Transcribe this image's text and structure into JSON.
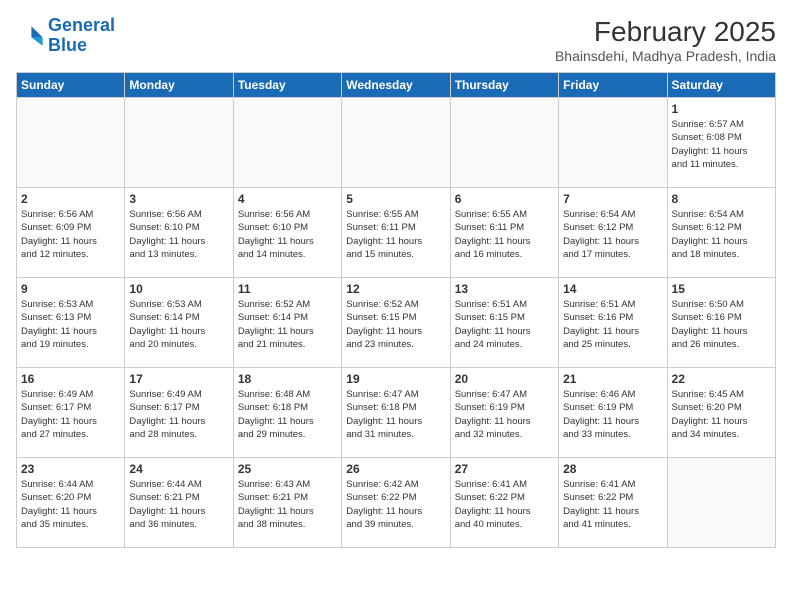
{
  "logo": {
    "line1": "General",
    "line2": "Blue"
  },
  "title": "February 2025",
  "location": "Bhainsdehi, Madhya Pradesh, India",
  "weekdays": [
    "Sunday",
    "Monday",
    "Tuesday",
    "Wednesday",
    "Thursday",
    "Friday",
    "Saturday"
  ],
  "weeks": [
    [
      {
        "day": "",
        "info": ""
      },
      {
        "day": "",
        "info": ""
      },
      {
        "day": "",
        "info": ""
      },
      {
        "day": "",
        "info": ""
      },
      {
        "day": "",
        "info": ""
      },
      {
        "day": "",
        "info": ""
      },
      {
        "day": "1",
        "info": "Sunrise: 6:57 AM\nSunset: 6:08 PM\nDaylight: 11 hours\nand 11 minutes."
      }
    ],
    [
      {
        "day": "2",
        "info": "Sunrise: 6:56 AM\nSunset: 6:09 PM\nDaylight: 11 hours\nand 12 minutes."
      },
      {
        "day": "3",
        "info": "Sunrise: 6:56 AM\nSunset: 6:10 PM\nDaylight: 11 hours\nand 13 minutes."
      },
      {
        "day": "4",
        "info": "Sunrise: 6:56 AM\nSunset: 6:10 PM\nDaylight: 11 hours\nand 14 minutes."
      },
      {
        "day": "5",
        "info": "Sunrise: 6:55 AM\nSunset: 6:11 PM\nDaylight: 11 hours\nand 15 minutes."
      },
      {
        "day": "6",
        "info": "Sunrise: 6:55 AM\nSunset: 6:11 PM\nDaylight: 11 hours\nand 16 minutes."
      },
      {
        "day": "7",
        "info": "Sunrise: 6:54 AM\nSunset: 6:12 PM\nDaylight: 11 hours\nand 17 minutes."
      },
      {
        "day": "8",
        "info": "Sunrise: 6:54 AM\nSunset: 6:12 PM\nDaylight: 11 hours\nand 18 minutes."
      }
    ],
    [
      {
        "day": "9",
        "info": "Sunrise: 6:53 AM\nSunset: 6:13 PM\nDaylight: 11 hours\nand 19 minutes."
      },
      {
        "day": "10",
        "info": "Sunrise: 6:53 AM\nSunset: 6:14 PM\nDaylight: 11 hours\nand 20 minutes."
      },
      {
        "day": "11",
        "info": "Sunrise: 6:52 AM\nSunset: 6:14 PM\nDaylight: 11 hours\nand 21 minutes."
      },
      {
        "day": "12",
        "info": "Sunrise: 6:52 AM\nSunset: 6:15 PM\nDaylight: 11 hours\nand 23 minutes."
      },
      {
        "day": "13",
        "info": "Sunrise: 6:51 AM\nSunset: 6:15 PM\nDaylight: 11 hours\nand 24 minutes."
      },
      {
        "day": "14",
        "info": "Sunrise: 6:51 AM\nSunset: 6:16 PM\nDaylight: 11 hours\nand 25 minutes."
      },
      {
        "day": "15",
        "info": "Sunrise: 6:50 AM\nSunset: 6:16 PM\nDaylight: 11 hours\nand 26 minutes."
      }
    ],
    [
      {
        "day": "16",
        "info": "Sunrise: 6:49 AM\nSunset: 6:17 PM\nDaylight: 11 hours\nand 27 minutes."
      },
      {
        "day": "17",
        "info": "Sunrise: 6:49 AM\nSunset: 6:17 PM\nDaylight: 11 hours\nand 28 minutes."
      },
      {
        "day": "18",
        "info": "Sunrise: 6:48 AM\nSunset: 6:18 PM\nDaylight: 11 hours\nand 29 minutes."
      },
      {
        "day": "19",
        "info": "Sunrise: 6:47 AM\nSunset: 6:18 PM\nDaylight: 11 hours\nand 31 minutes."
      },
      {
        "day": "20",
        "info": "Sunrise: 6:47 AM\nSunset: 6:19 PM\nDaylight: 11 hours\nand 32 minutes."
      },
      {
        "day": "21",
        "info": "Sunrise: 6:46 AM\nSunset: 6:19 PM\nDaylight: 11 hours\nand 33 minutes."
      },
      {
        "day": "22",
        "info": "Sunrise: 6:45 AM\nSunset: 6:20 PM\nDaylight: 11 hours\nand 34 minutes."
      }
    ],
    [
      {
        "day": "23",
        "info": "Sunrise: 6:44 AM\nSunset: 6:20 PM\nDaylight: 11 hours\nand 35 minutes."
      },
      {
        "day": "24",
        "info": "Sunrise: 6:44 AM\nSunset: 6:21 PM\nDaylight: 11 hours\nand 36 minutes."
      },
      {
        "day": "25",
        "info": "Sunrise: 6:43 AM\nSunset: 6:21 PM\nDaylight: 11 hours\nand 38 minutes."
      },
      {
        "day": "26",
        "info": "Sunrise: 6:42 AM\nSunset: 6:22 PM\nDaylight: 11 hours\nand 39 minutes."
      },
      {
        "day": "27",
        "info": "Sunrise: 6:41 AM\nSunset: 6:22 PM\nDaylight: 11 hours\nand 40 minutes."
      },
      {
        "day": "28",
        "info": "Sunrise: 6:41 AM\nSunset: 6:22 PM\nDaylight: 11 hours\nand 41 minutes."
      },
      {
        "day": "",
        "info": ""
      }
    ]
  ]
}
